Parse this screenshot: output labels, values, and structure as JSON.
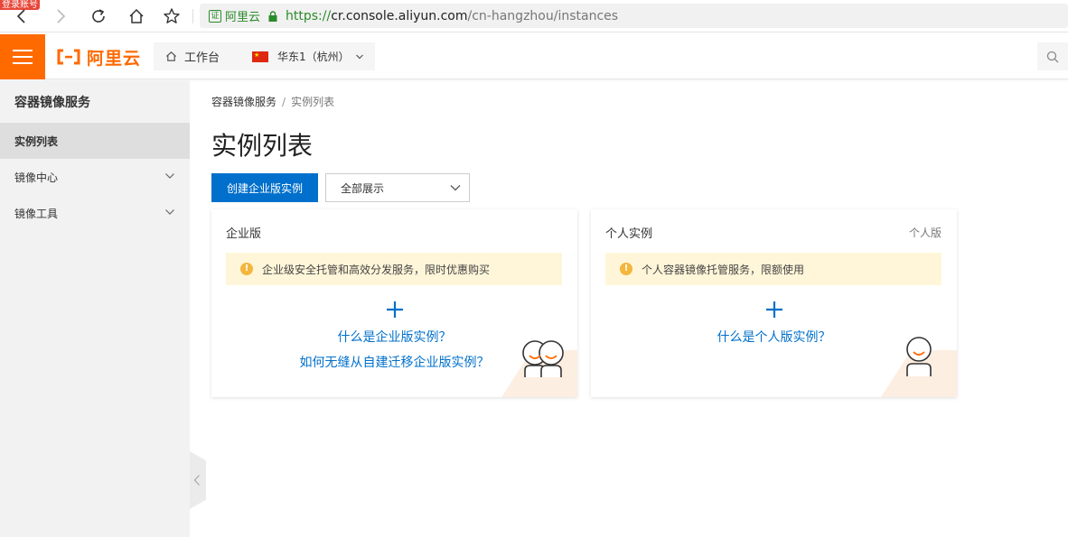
{
  "browser": {
    "login_tag": "登录账号",
    "cert_label": "阿里云",
    "cert_badge": "证",
    "url_scheme": "https://",
    "url_host": "cr.console.aliyun.com",
    "url_path": "/cn-hangzhou/instances"
  },
  "topbar": {
    "logo_text": "阿里云",
    "workbench_label": "工作台",
    "region_label": "华东1（杭州）"
  },
  "sidebar": {
    "title": "容器镜像服务",
    "items": [
      {
        "label": "实例列表",
        "active": true
      },
      {
        "label": "镜像中心",
        "expandable": true
      },
      {
        "label": "镜像工具",
        "expandable": true
      }
    ]
  },
  "main": {
    "breadcrumb": [
      "容器镜像服务",
      "实例列表"
    ],
    "breadcrumb_separator": "/",
    "title": "实例列表",
    "create_button": "创建企业版实例",
    "filter_value": "全部展示"
  },
  "cards": {
    "enterprise": {
      "title": "企业版",
      "notice": "企业级安全托管和高效分发服务，限时优惠购买",
      "links": [
        "什么是企业版实例？",
        "如何无缝从自建迁移企业版实例？"
      ]
    },
    "personal": {
      "title": "个人实例",
      "tag": "个人版",
      "notice": "个人容器镜像托管服务，限额使用",
      "links": [
        "什么是个人版实例？"
      ]
    }
  },
  "colors": {
    "brand": "#ff6a00",
    "primary": "#0070cc",
    "notice_bg": "#fff6d9",
    "warning": "#f4b63d"
  }
}
